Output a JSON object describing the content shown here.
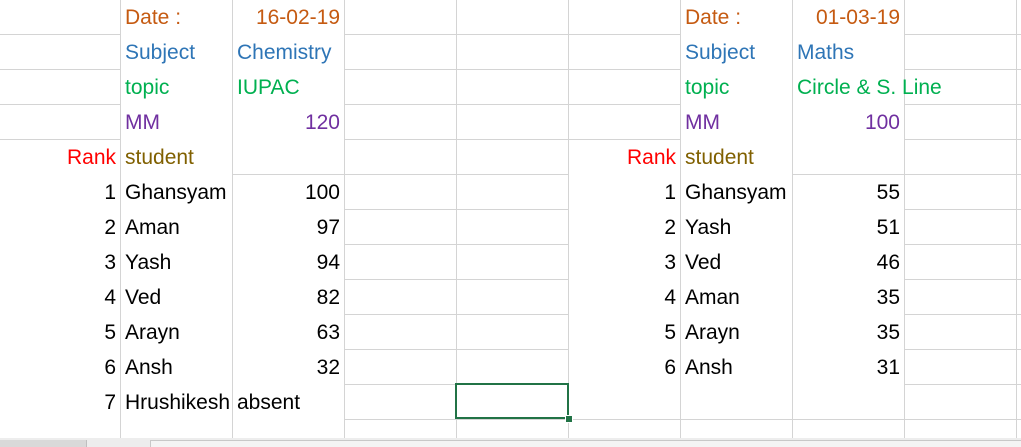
{
  "sheet1": {
    "date_label": "Date :",
    "date_value": "16-02-19",
    "subject_label": "Subject",
    "subject_value": "Chemistry",
    "topic_label": "topic",
    "topic_value": "IUPAC",
    "mm_label": "MM",
    "mm_value": "120",
    "rank_header": "Rank",
    "student_header": "student",
    "rows": [
      {
        "rank": "1",
        "name": "Ghansyam",
        "score": "100"
      },
      {
        "rank": "2",
        "name": "Aman",
        "score": "97"
      },
      {
        "rank": "3",
        "name": "Yash",
        "score": "94"
      },
      {
        "rank": "4",
        "name": "Ved",
        "score": "82"
      },
      {
        "rank": "5",
        "name": "Arayn",
        "score": "63"
      },
      {
        "rank": "6",
        "name": "Ansh",
        "score": "32"
      },
      {
        "rank": "7",
        "name": "Hrushikesh",
        "score": "absent"
      }
    ]
  },
  "sheet2": {
    "date_label": "Date :",
    "date_value": "01-03-19",
    "subject_label": "Subject",
    "subject_value": "Maths",
    "topic_label": "topic",
    "topic_value": "Circle & S. Line",
    "mm_label": "MM",
    "mm_value": "100",
    "rank_header": "Rank",
    "student_header": "student",
    "rows": [
      {
        "rank": "1",
        "name": "Ghansyam",
        "score": "55"
      },
      {
        "rank": "2",
        "name": "Yash",
        "score": "51"
      },
      {
        "rank": "3",
        "name": "Ved",
        "score": "46"
      },
      {
        "rank": "4",
        "name": "Aman",
        "score": "35"
      },
      {
        "rank": "5",
        "name": "Arayn",
        "score": "35"
      },
      {
        "rank": "6",
        "name": "Ansh",
        "score": "31"
      }
    ]
  }
}
